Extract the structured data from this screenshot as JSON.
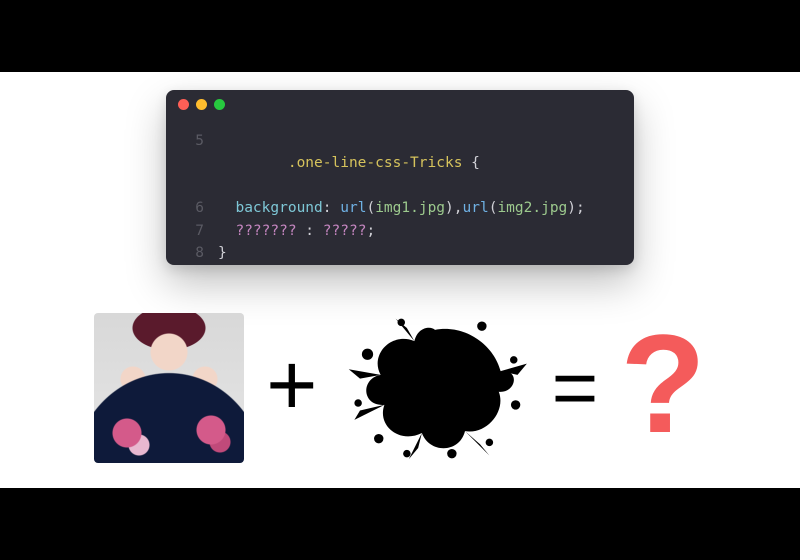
{
  "letterbox": {
    "color": "#000000"
  },
  "editor": {
    "window_dots": [
      "red",
      "yellow",
      "green"
    ],
    "lines": [
      {
        "num": "5",
        "selector": ".one-line-css-Tricks",
        "open": " {"
      },
      {
        "num": "6",
        "indent": "  ",
        "prop": "background",
        "colon": ": ",
        "func1": "url",
        "arg1": "img1.jpg",
        "sep": ",",
        "func2": "url",
        "arg2": "img2.jpg",
        "end": ";"
      },
      {
        "num": "7",
        "indent": "  ",
        "mystery_prop": "???????",
        "colon": " : ",
        "mystery_val": "?????",
        "end": ";"
      },
      {
        "num": "8",
        "close": "}"
      }
    ]
  },
  "equation": {
    "plus": "+",
    "equals": "=",
    "result": "?",
    "result_color": "#f45b5b",
    "photo_alt": "woman-with-floral-dress",
    "splat_alt": "black-ink-splat-mask"
  }
}
